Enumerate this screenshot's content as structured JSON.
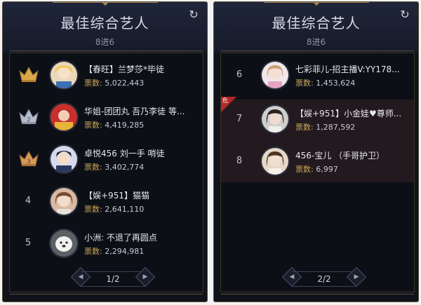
{
  "panels": [
    {
      "title": "最佳综合艺人",
      "subtitle": "8进6",
      "page": "1/2",
      "entries": [
        {
          "rank": "1",
          "name": "【春旺】兰梦莎*毕徒",
          "vote_label": "票数:",
          "votes": "5,022,443"
        },
        {
          "rank": "2",
          "name": "华姐-团团丸 吾乃李徒 等...",
          "vote_label": "票数:",
          "votes": "4,419,285"
        },
        {
          "rank": "3",
          "name": "卓悦456 刘一手 哨徒",
          "vote_label": "票数:",
          "votes": "3,402,774"
        },
        {
          "rank": "4",
          "name": "【娱+951】猫猫",
          "vote_label": "票数:",
          "votes": "2,641,110"
        },
        {
          "rank": "5",
          "name": "小洲: 不退了再圆点",
          "vote_label": "票数:",
          "votes": "2,294,981"
        }
      ]
    },
    {
      "title": "最佳综合艺人",
      "subtitle": "8进6",
      "page": "2/2",
      "entries": [
        {
          "rank": "6",
          "name": "七彩菲儿-招主播V:YY178...",
          "vote_label": "票数:",
          "votes": "1,453,624"
        },
        {
          "rank": "7",
          "name": "【娱+951】小金娃♥尊师...",
          "vote_label": "票数:",
          "votes": "1,287,592",
          "tag": "危"
        },
        {
          "rank": "8",
          "name": "456-宝儿 （手哥护卫）",
          "vote_label": "票数:",
          "votes": "6,997"
        }
      ]
    }
  ],
  "colors": {
    "gold": "#c9a85a",
    "highlight_row": "#231a1f",
    "danger_tag": "#b02828"
  },
  "icons": {
    "crown": "crown-icon",
    "refresh": "refresh-icon",
    "prev": "chevron-left-icon",
    "next": "chevron-right-icon"
  }
}
